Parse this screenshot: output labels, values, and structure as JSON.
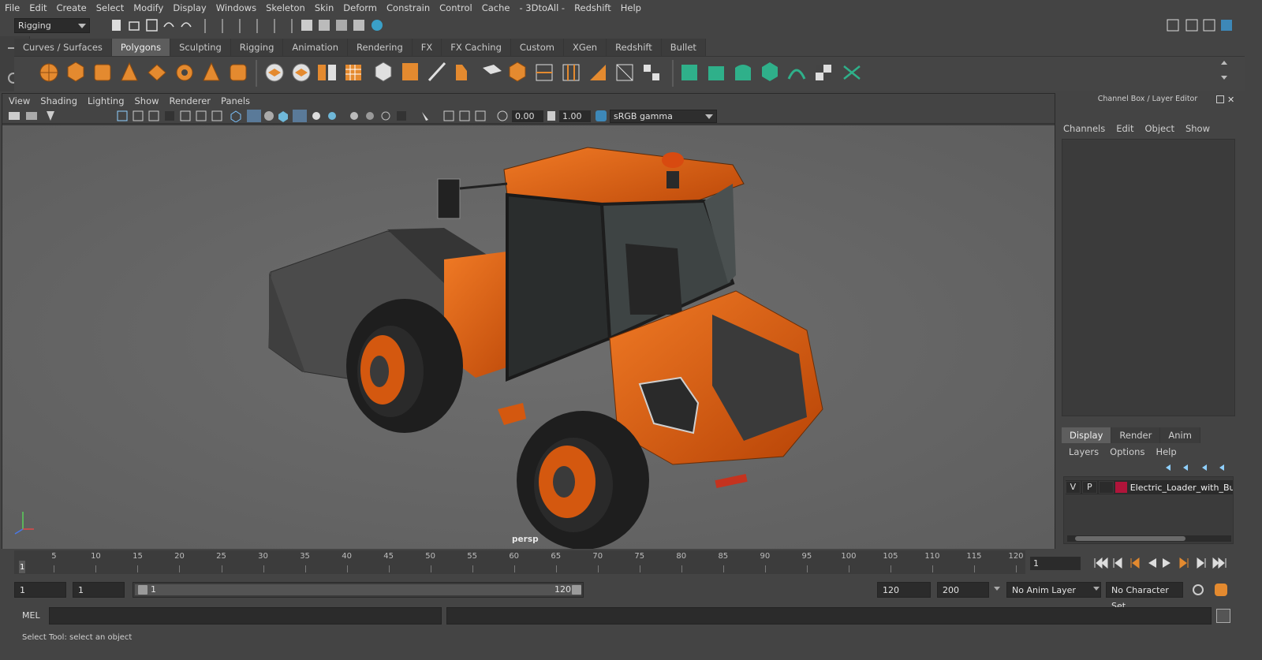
{
  "menubar": [
    "File",
    "Edit",
    "Create",
    "Select",
    "Modify",
    "Display",
    "Windows",
    "Skeleton",
    "Skin",
    "Deform",
    "Constrain",
    "Control",
    "Cache",
    "- 3DtoAll -",
    "Redshift",
    "Help"
  ],
  "workspace": {
    "selected": "Rigging"
  },
  "shelf": {
    "tabs": [
      "Curves / Surfaces",
      "Polygons",
      "Sculpting",
      "Rigging",
      "Animation",
      "Rendering",
      "FX",
      "FX Caching",
      "Custom",
      "XGen",
      "Redshift",
      "Bullet"
    ],
    "active_tab": "Polygons"
  },
  "viewport": {
    "menu": [
      "View",
      "Shading",
      "Lighting",
      "Show",
      "Renderer",
      "Panels"
    ],
    "exposure": "0.00",
    "gamma": "1.00",
    "color_space": "sRGB gamma",
    "camera_label": "persp"
  },
  "right_panel": {
    "title": "Channel Box / Layer Editor",
    "channel_menu": [
      "Channels",
      "Edit",
      "Object",
      "Show"
    ],
    "lower_tabs": [
      "Display",
      "Render",
      "Anim"
    ],
    "active_lower_tab": "Display",
    "layer_menu": [
      "Layers",
      "Options",
      "Help"
    ],
    "layer": {
      "v": "V",
      "p": "P",
      "name": "Electric_Loader_with_Buc",
      "color": "#b0143a"
    }
  },
  "timeline": {
    "ticks": [
      "1",
      "5",
      "10",
      "15",
      "20",
      "25",
      "30",
      "35",
      "40",
      "45",
      "50",
      "55",
      "60",
      "65",
      "70",
      "75",
      "80",
      "85",
      "90",
      "95",
      "100",
      "105",
      "110",
      "115",
      "120"
    ],
    "current_frame": "1",
    "current_frame_field": "1"
  },
  "range": {
    "start_field": "1",
    "playback_start": "1",
    "slider_start": "1",
    "slider_end": "120",
    "playback_end": "120",
    "end_field": "200",
    "anim_layer": "No Anim Layer",
    "character_set": "No Character Set"
  },
  "command_line": {
    "label": "MEL"
  },
  "status_line": "Select Tool: select an object",
  "colors": {
    "loader_orange": "#d2570f",
    "layer_red": "#b0143a",
    "accent_blue": "#5aa9d8"
  }
}
